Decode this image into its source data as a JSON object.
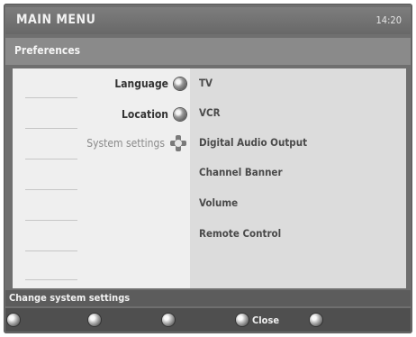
{
  "header": {
    "title": "MAIN MENU",
    "clock": "14:20"
  },
  "subheader": {
    "title": "Preferences"
  },
  "left_menu": [
    {
      "label": "Language",
      "state": "normal",
      "icon": "knob-icon"
    },
    {
      "label": "Location",
      "state": "normal",
      "icon": "knob-icon"
    },
    {
      "label": "System settings",
      "state": "selected",
      "icon": "dpad-icon"
    }
  ],
  "right_menu": [
    {
      "label": "TV"
    },
    {
      "label": "VCR"
    },
    {
      "label": "Digital Audio Output"
    },
    {
      "label": "Channel Banner"
    },
    {
      "label": "Volume"
    },
    {
      "label": "Remote Control"
    }
  ],
  "status": {
    "text": "Change system settings"
  },
  "bottom_buttons": [
    {
      "label": ""
    },
    {
      "label": ""
    },
    {
      "label": ""
    },
    {
      "label": "Close"
    },
    {
      "label": ""
    }
  ]
}
